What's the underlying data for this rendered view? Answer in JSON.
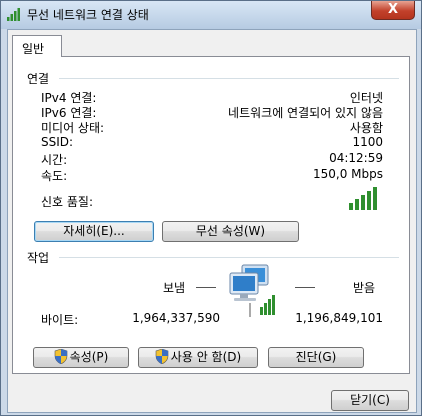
{
  "window": {
    "title": "무선 네트워크 연결 상태",
    "close_label": "X"
  },
  "tabs": [
    {
      "label": "일반"
    }
  ],
  "connection": {
    "heading": "연결",
    "rows": [
      {
        "label": "IPv4 연결:",
        "value": "인터넷"
      },
      {
        "label": "IPv6 연결:",
        "value": "네트워크에 연결되어 있지 않음"
      },
      {
        "label": "미디어 상태:",
        "value": "사용함"
      },
      {
        "label": "SSID:",
        "value": "1100"
      },
      {
        "label": "시간:",
        "value": "04:12:59"
      },
      {
        "label": "속도:",
        "value": "150,0 Mbps"
      }
    ],
    "signal_label": "신호 품질:",
    "signal_bars": 5,
    "details_button": "자세히(E)...",
    "wireless_props_button": "무선 속성(W)"
  },
  "activity": {
    "heading": "작업",
    "sent_label": "보냄",
    "received_label": "받음",
    "bytes_label": "바이트:",
    "bytes_sent": "1,964,337,590",
    "bytes_received": "1,196,849,101"
  },
  "buttons": {
    "properties": "속성(P)",
    "disable": "사용 안 함(D)",
    "diagnose": "진단(G)",
    "close": "닫기(C)"
  },
  "colors": {
    "signal_green": "#2f8f2f",
    "title_bar": "#c5d7ec",
    "close_red": "#c2412b"
  }
}
